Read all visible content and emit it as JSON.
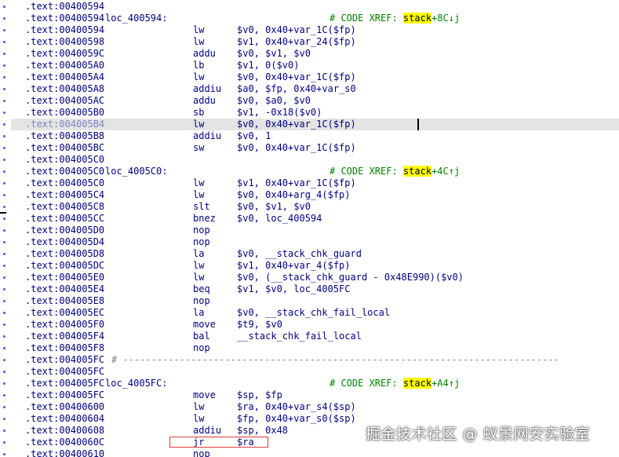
{
  "listing": {
    "current_line_index": 10,
    "lines": [
      {
        "addr": ".text:00400594"
      },
      {
        "addr": ".text:00400594",
        "label": "loc_400594:",
        "comment_prefix": "# CODE XREF: ",
        "comment_hl": "stack",
        "comment_rest": "+8C↓j"
      },
      {
        "addr": ".text:00400594",
        "mnemonic": "lw",
        "operands": "$v0, 0x40+var_1C($fp)"
      },
      {
        "addr": ".text:00400598",
        "mnemonic": "lw",
        "operands": "$v1, 0x40+var_24($fp)"
      },
      {
        "addr": ".text:0040059C",
        "mnemonic": "addu",
        "operands": "$v0, $v1, $v0"
      },
      {
        "addr": ".text:004005A0",
        "mnemonic": "lb",
        "operands": "$v1, 0($v0)"
      },
      {
        "addr": ".text:004005A4",
        "mnemonic": "lw",
        "operands": "$v0, 0x40+var_1C($fp)"
      },
      {
        "addr": ".text:004005A8",
        "mnemonic": "addiu",
        "operands": "$a0, $fp, 0x40+var_s0"
      },
      {
        "addr": ".text:004005AC",
        "mnemonic": "addu",
        "operands": "$v0, $a0, $v0"
      },
      {
        "addr": ".text:004005B0",
        "mnemonic": "sb",
        "operands": "$v1, -0x18($v0)"
      },
      {
        "addr": ".text:004005B4",
        "mnemonic": "lw",
        "operands": "$v0, 0x40+var_1C($fp)"
      },
      {
        "addr": ".text:004005B8",
        "mnemonic": "addiu",
        "operands": "$v0, 1"
      },
      {
        "addr": ".text:004005BC",
        "mnemonic": "sw",
        "operands": "$v0, 0x40+var_1C($fp)"
      },
      {
        "addr": ".text:004005C0"
      },
      {
        "addr": ".text:004005C0",
        "label": "loc_4005C0:",
        "comment_prefix": "# CODE XREF: ",
        "comment_hl": "stack",
        "comment_rest": "+4C↑j"
      },
      {
        "addr": ".text:004005C0",
        "mnemonic": "lw",
        "operands": "$v1, 0x40+var_1C($fp)"
      },
      {
        "addr": ".text:004005C4",
        "mnemonic": "lw",
        "operands": "$v0, 0x40+arg_4($fp)"
      },
      {
        "addr": ".text:004005C8",
        "mnemonic": "slt",
        "operands": "$v0, $v1, $v0"
      },
      {
        "addr": ".text:004005CC",
        "mnemonic": "bnez",
        "operands": "$v0, loc_400594"
      },
      {
        "addr": ".text:004005D0",
        "mnemonic": "nop",
        "operands": ""
      },
      {
        "addr": ".text:004005D4",
        "mnemonic": "nop",
        "operands": ""
      },
      {
        "addr": ".text:004005D8",
        "mnemonic": "la",
        "operands": "$v0, __stack_chk_guard"
      },
      {
        "addr": ".text:004005DC",
        "mnemonic": "lw",
        "operands": "$v1, 0x40+var_4($fp)"
      },
      {
        "addr": ".text:004005E0",
        "mnemonic": "lw",
        "operands": "$v0, (__stack_chk_guard - 0x48E990)($v0)"
      },
      {
        "addr": ".text:004005E4",
        "mnemonic": "beq",
        "operands": "$v1, $v0, loc_4005FC"
      },
      {
        "addr": ".text:004005E8",
        "mnemonic": "nop",
        "operands": ""
      },
      {
        "addr": ".text:004005EC",
        "mnemonic": "la",
        "operands": "$v0, __stack_chk_fail_local"
      },
      {
        "addr": ".text:004005F0",
        "mnemonic": "move",
        "operands": "$t9, $v0"
      },
      {
        "addr": ".text:004005F4",
        "mnemonic": "bal",
        "operands": "__stack_chk_fail_local"
      },
      {
        "addr": ".text:004005F8",
        "mnemonic": "nop",
        "operands": ""
      },
      {
        "addr": ".text:004005FC",
        "separator": "# -----------------------------------------------------------------------------"
      },
      {
        "addr": ".text:004005FC"
      },
      {
        "addr": ".text:004005FC",
        "label": "loc_4005FC:",
        "comment_prefix": "# CODE XREF: ",
        "comment_hl": "stack",
        "comment_rest": "+A4↑j"
      },
      {
        "addr": ".text:004005FC",
        "mnemonic": "move",
        "operands": "$sp, $fp"
      },
      {
        "addr": ".text:00400600",
        "mnemonic": "lw",
        "operands": "$ra, 0x40+var_s4($sp)"
      },
      {
        "addr": ".text:00400604",
        "mnemonic": "lw",
        "operands": "$fp, 0x40+var_s0($sp)"
      },
      {
        "addr": ".text:00400608",
        "mnemonic": "addiu",
        "operands": "$sp, 0x48"
      },
      {
        "addr": ".text:0040060C",
        "mnemonic": "jr",
        "operands": "$ra"
      },
      {
        "addr": ".text:00400610",
        "mnemonic": "nop",
        "operands": ""
      }
    ]
  },
  "watermark": "掘金技术社区 @ 蚁景网安实验室",
  "colors": {
    "code": "#000080",
    "comment": "#008000",
    "xref_highlight": "#ffff00",
    "current_line": "#e4e4e4",
    "gutter_dot": "#3a5edb",
    "annotation_box": "#e03a3a"
  }
}
